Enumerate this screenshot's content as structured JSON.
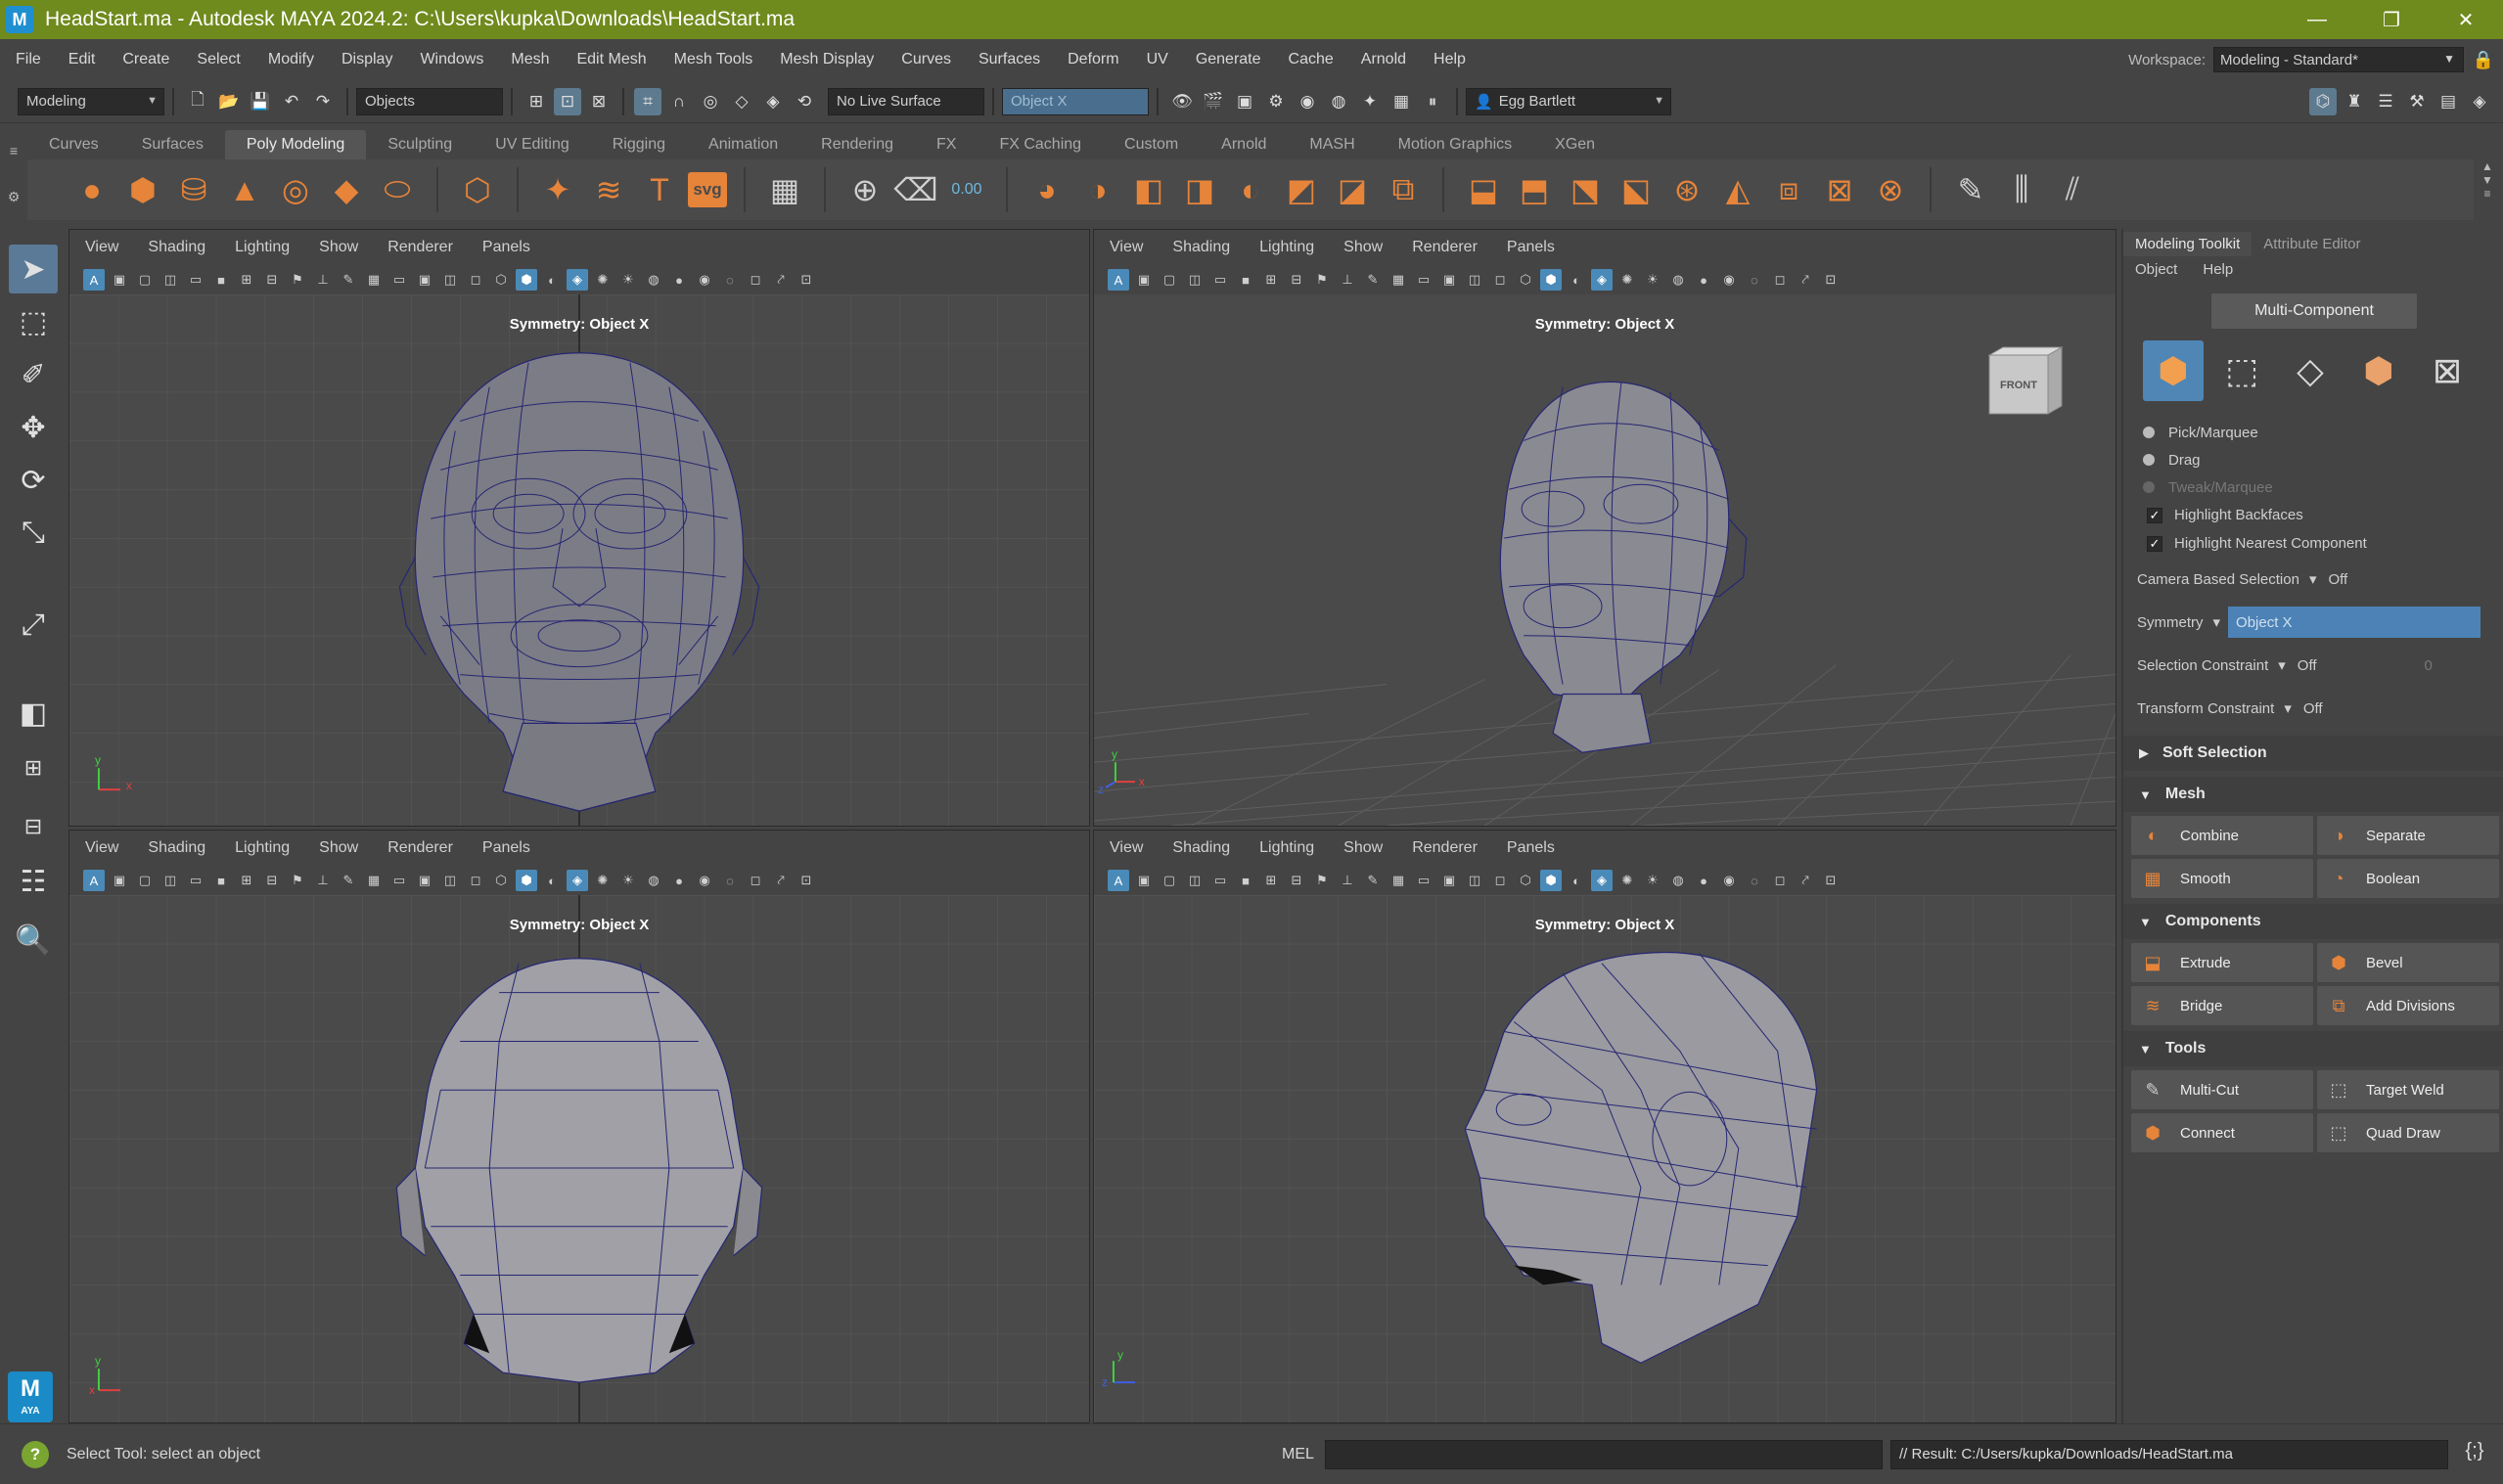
{
  "window": {
    "title": "HeadStart.ma - Autodesk MAYA 2024.2: C:\\Users\\kupka\\Downloads\\HeadStart.ma",
    "logo": "M",
    "controls": [
      "—",
      "❐",
      "✕"
    ]
  },
  "menubar": {
    "items": [
      "File",
      "Edit",
      "Create",
      "Select",
      "Modify",
      "Display",
      "Windows",
      "Mesh",
      "Edit Mesh",
      "Mesh Tools",
      "Mesh Display",
      "Curves",
      "Surfaces",
      "Deform",
      "UV",
      "Generate",
      "Cache",
      "Arnold",
      "Help"
    ],
    "workspace_label": "Workspace:",
    "workspace_value": "Modeling - Standard*"
  },
  "statusline": {
    "menu_set": "Modeling",
    "selection_mask": "Objects",
    "live_surface": "No Live Surface",
    "symmetry": "Object X",
    "user": "Egg Bartlett"
  },
  "shelf": {
    "tabs": [
      "Curves",
      "Surfaces",
      "Poly Modeling",
      "Sculpting",
      "UV Editing",
      "Rigging",
      "Animation",
      "Rendering",
      "FX",
      "FX Caching",
      "Custom",
      "Arnold",
      "MASH",
      "Motion Graphics",
      "XGen"
    ],
    "active_tab": "Poly Modeling",
    "svg_label": "svg",
    "text_label": "T",
    "counter_label": "0.00"
  },
  "viewport": {
    "menu": [
      "View",
      "Shading",
      "Lighting",
      "Show",
      "Renderer",
      "Panels"
    ],
    "symmetry_label": "Symmetry: Object X",
    "viewcube_label": "FRONT",
    "axis_x": "x",
    "axis_y": "y",
    "axis_z": "z"
  },
  "toolkit": {
    "tabs": [
      "Modeling Toolkit",
      "Attribute Editor"
    ],
    "menu": [
      "Object",
      "Help"
    ],
    "multi_component": "Multi-Component",
    "selection_modes": [
      "Pick/Marquee",
      "Drag",
      "Tweak/Marquee"
    ],
    "checks": [
      "Highlight Backfaces",
      "Highlight Nearest Component"
    ],
    "camera_based_selection": {
      "label": "Camera Based Selection",
      "value": "Off"
    },
    "symmetry": {
      "label": "Symmetry",
      "value": "Object X"
    },
    "selection_constraint": {
      "label": "Selection Constraint",
      "value": "Off",
      "extra": "0"
    },
    "transform_constraint": {
      "label": "Transform Constraint",
      "value": "Off"
    },
    "soft_selection": "Soft Selection",
    "mesh_section": "Mesh",
    "mesh_buttons": [
      "Combine",
      "Separate",
      "Smooth",
      "Boolean"
    ],
    "components_section": "Components",
    "components_buttons": [
      "Extrude",
      "Bevel",
      "Bridge",
      "Add Divisions"
    ],
    "tools_section": "Tools",
    "tools_buttons": [
      "Multi-Cut",
      "Target Weld",
      "Connect",
      "Quad Draw"
    ]
  },
  "helpline": {
    "help_text": "Select Tool: select an object",
    "mel_label": "MEL",
    "result": "// Result: C:/Users/kupka/Downloads/HeadStart.ma"
  },
  "colors": {
    "titlebar": "#6f8a1d",
    "accent_blue": "#4f86b6",
    "shelf_orange": "#e6843a",
    "wire": "#2a2a7a"
  }
}
